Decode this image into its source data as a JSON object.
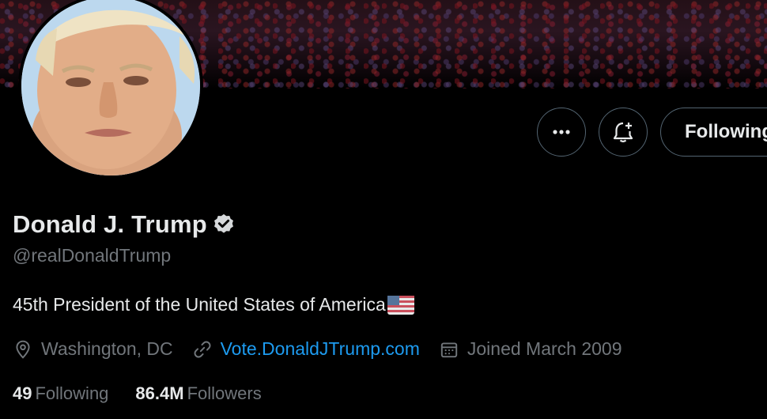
{
  "profile": {
    "name": "Donald J. Trump",
    "handle": "@realDonaldTrump",
    "bio": "45th President of the United States of America",
    "location": "Washington, DC",
    "website": "Vote.DonaldJTrump.com",
    "joined": "Joined March 2009",
    "following_count": "49",
    "following_label": "Following",
    "followers_count": "86.4M",
    "followers_label": "Followers"
  },
  "actions": {
    "more_icon": "more-horizontal-icon",
    "notify_icon": "bell-plus-icon",
    "follow_label": "Following"
  },
  "icons": {
    "verified": "verified-badge-icon",
    "flag": "us-flag-emoji",
    "location": "location-pin-icon",
    "link": "link-icon",
    "calendar": "calendar-icon"
  },
  "colors": {
    "background": "#000000",
    "primary_text": "#e7e9ea",
    "secondary_text": "#71767b",
    "link": "#1d9bf0",
    "border": "#536471"
  }
}
